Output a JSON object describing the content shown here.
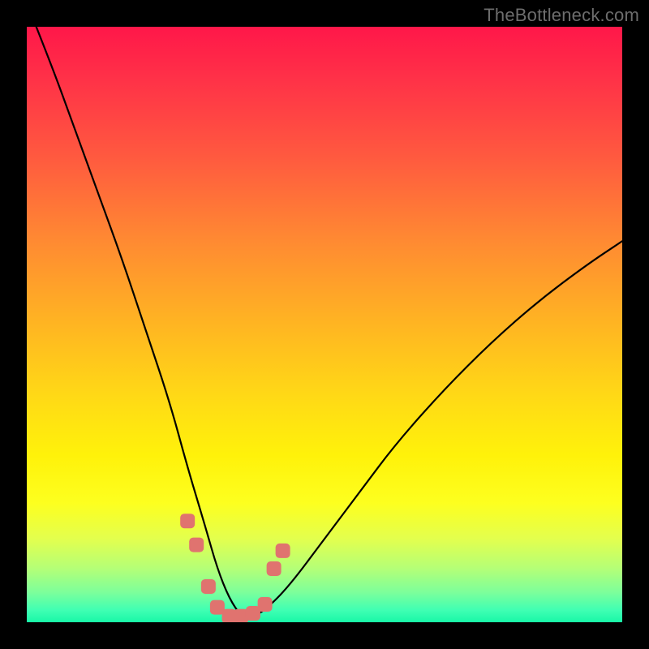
{
  "watermark": "TheBottleneck.com",
  "chart_data": {
    "type": "line",
    "title": "",
    "xlabel": "",
    "ylabel": "",
    "xlim": [
      0,
      100
    ],
    "ylim": [
      0,
      100
    ],
    "series": [
      {
        "name": "bottleneck-curve",
        "x": [
          0,
          4,
          8,
          12,
          16,
          20,
          24,
          27,
          30,
          32,
          34,
          36,
          38,
          40,
          44,
          50,
          56,
          62,
          70,
          78,
          86,
          94,
          100
        ],
        "y": [
          104,
          94,
          83,
          72,
          61,
          49,
          37,
          26,
          16,
          9,
          4,
          1,
          1,
          2,
          6,
          14,
          22,
          30,
          39,
          47,
          54,
          60,
          64
        ]
      }
    ],
    "markers": {
      "name": "highlight-points",
      "color": "#e0736f",
      "x": [
        27.0,
        28.5,
        30.5,
        32.0,
        34.0,
        36.0,
        38.0,
        40.0,
        41.5,
        43.0
      ],
      "y": [
        17.0,
        13.0,
        6.0,
        2.5,
        1.0,
        1.0,
        1.5,
        3.0,
        9.0,
        12.0
      ]
    },
    "gradient_stops": [
      {
        "pos": 0.0,
        "color": "#ff1749"
      },
      {
        "pos": 0.22,
        "color": "#ff5a3f"
      },
      {
        "pos": 0.5,
        "color": "#ffb522"
      },
      {
        "pos": 0.72,
        "color": "#fff20a"
      },
      {
        "pos": 0.91,
        "color": "#b4ff77"
      },
      {
        "pos": 1.0,
        "color": "#18f7a7"
      }
    ]
  }
}
